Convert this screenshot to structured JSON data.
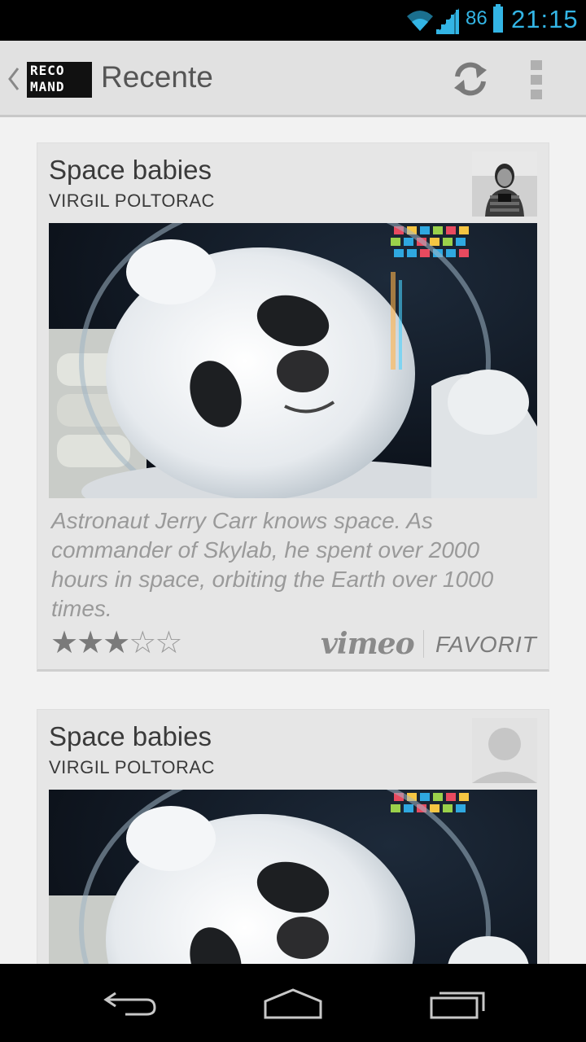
{
  "status": {
    "battery_pct": "86",
    "time": "21:15"
  },
  "action_bar": {
    "logo_line1": "RECO",
    "logo_line2": "MAND",
    "title": "Recente"
  },
  "icons": {
    "up": "chevron-left-icon",
    "refresh": "refresh-icon",
    "overflow": "overflow-menu-icon",
    "back": "back-icon",
    "home": "home-icon",
    "recents": "recent-apps-icon"
  },
  "colors": {
    "status_accent": "#33b5e5",
    "action_bar_bg": "#e1e1e1",
    "card_bg": "#e6e6e6"
  },
  "cards": [
    {
      "title": "Space babies",
      "author": "VIRGIL POLTORAC",
      "description": "Astronaut Jerry Carr knows space. As commander of Skylab, he spent over 2000 hours in space, orbiting the Earth over 1000 times.",
      "rating": 3,
      "rating_max": 5,
      "source": "vimeo",
      "action": "FAVORIT"
    },
    {
      "title": "Space babies",
      "author": "VIRGIL POLTORAC"
    }
  ]
}
